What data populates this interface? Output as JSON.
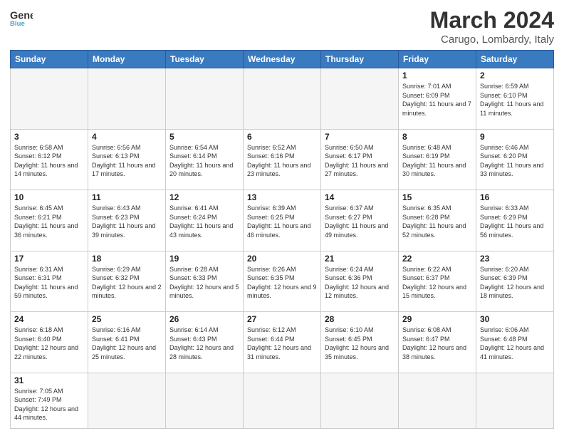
{
  "header": {
    "logo_general": "General",
    "logo_blue": "Blue",
    "month": "March 2024",
    "location": "Carugo, Lombardy, Italy"
  },
  "days_of_week": [
    "Sunday",
    "Monday",
    "Tuesday",
    "Wednesday",
    "Thursday",
    "Friday",
    "Saturday"
  ],
  "weeks": [
    [
      {
        "day": "",
        "info": ""
      },
      {
        "day": "",
        "info": ""
      },
      {
        "day": "",
        "info": ""
      },
      {
        "day": "",
        "info": ""
      },
      {
        "day": "",
        "info": ""
      },
      {
        "day": "1",
        "info": "Sunrise: 7:01 AM\nSunset: 6:09 PM\nDaylight: 11 hours and 7 minutes."
      },
      {
        "day": "2",
        "info": "Sunrise: 6:59 AM\nSunset: 6:10 PM\nDaylight: 11 hours and 11 minutes."
      }
    ],
    [
      {
        "day": "3",
        "info": "Sunrise: 6:58 AM\nSunset: 6:12 PM\nDaylight: 11 hours and 14 minutes."
      },
      {
        "day": "4",
        "info": "Sunrise: 6:56 AM\nSunset: 6:13 PM\nDaylight: 11 hours and 17 minutes."
      },
      {
        "day": "5",
        "info": "Sunrise: 6:54 AM\nSunset: 6:14 PM\nDaylight: 11 hours and 20 minutes."
      },
      {
        "day": "6",
        "info": "Sunrise: 6:52 AM\nSunset: 6:16 PM\nDaylight: 11 hours and 23 minutes."
      },
      {
        "day": "7",
        "info": "Sunrise: 6:50 AM\nSunset: 6:17 PM\nDaylight: 11 hours and 27 minutes."
      },
      {
        "day": "8",
        "info": "Sunrise: 6:48 AM\nSunset: 6:19 PM\nDaylight: 11 hours and 30 minutes."
      },
      {
        "day": "9",
        "info": "Sunrise: 6:46 AM\nSunset: 6:20 PM\nDaylight: 11 hours and 33 minutes."
      }
    ],
    [
      {
        "day": "10",
        "info": "Sunrise: 6:45 AM\nSunset: 6:21 PM\nDaylight: 11 hours and 36 minutes."
      },
      {
        "day": "11",
        "info": "Sunrise: 6:43 AM\nSunset: 6:23 PM\nDaylight: 11 hours and 39 minutes."
      },
      {
        "day": "12",
        "info": "Sunrise: 6:41 AM\nSunset: 6:24 PM\nDaylight: 11 hours and 43 minutes."
      },
      {
        "day": "13",
        "info": "Sunrise: 6:39 AM\nSunset: 6:25 PM\nDaylight: 11 hours and 46 minutes."
      },
      {
        "day": "14",
        "info": "Sunrise: 6:37 AM\nSunset: 6:27 PM\nDaylight: 11 hours and 49 minutes."
      },
      {
        "day": "15",
        "info": "Sunrise: 6:35 AM\nSunset: 6:28 PM\nDaylight: 11 hours and 52 minutes."
      },
      {
        "day": "16",
        "info": "Sunrise: 6:33 AM\nSunset: 6:29 PM\nDaylight: 11 hours and 56 minutes."
      }
    ],
    [
      {
        "day": "17",
        "info": "Sunrise: 6:31 AM\nSunset: 6:31 PM\nDaylight: 11 hours and 59 minutes."
      },
      {
        "day": "18",
        "info": "Sunrise: 6:29 AM\nSunset: 6:32 PM\nDaylight: 12 hours and 2 minutes."
      },
      {
        "day": "19",
        "info": "Sunrise: 6:28 AM\nSunset: 6:33 PM\nDaylight: 12 hours and 5 minutes."
      },
      {
        "day": "20",
        "info": "Sunrise: 6:26 AM\nSunset: 6:35 PM\nDaylight: 12 hours and 9 minutes."
      },
      {
        "day": "21",
        "info": "Sunrise: 6:24 AM\nSunset: 6:36 PM\nDaylight: 12 hours and 12 minutes."
      },
      {
        "day": "22",
        "info": "Sunrise: 6:22 AM\nSunset: 6:37 PM\nDaylight: 12 hours and 15 minutes."
      },
      {
        "day": "23",
        "info": "Sunrise: 6:20 AM\nSunset: 6:39 PM\nDaylight: 12 hours and 18 minutes."
      }
    ],
    [
      {
        "day": "24",
        "info": "Sunrise: 6:18 AM\nSunset: 6:40 PM\nDaylight: 12 hours and 22 minutes."
      },
      {
        "day": "25",
        "info": "Sunrise: 6:16 AM\nSunset: 6:41 PM\nDaylight: 12 hours and 25 minutes."
      },
      {
        "day": "26",
        "info": "Sunrise: 6:14 AM\nSunset: 6:43 PM\nDaylight: 12 hours and 28 minutes."
      },
      {
        "day": "27",
        "info": "Sunrise: 6:12 AM\nSunset: 6:44 PM\nDaylight: 12 hours and 31 minutes."
      },
      {
        "day": "28",
        "info": "Sunrise: 6:10 AM\nSunset: 6:45 PM\nDaylight: 12 hours and 35 minutes."
      },
      {
        "day": "29",
        "info": "Sunrise: 6:08 AM\nSunset: 6:47 PM\nDaylight: 12 hours and 38 minutes."
      },
      {
        "day": "30",
        "info": "Sunrise: 6:06 AM\nSunset: 6:48 PM\nDaylight: 12 hours and 41 minutes."
      }
    ],
    [
      {
        "day": "31",
        "info": "Sunrise: 7:05 AM\nSunset: 7:49 PM\nDaylight: 12 hours and 44 minutes."
      },
      {
        "day": "",
        "info": ""
      },
      {
        "day": "",
        "info": ""
      },
      {
        "day": "",
        "info": ""
      },
      {
        "day": "",
        "info": ""
      },
      {
        "day": "",
        "info": ""
      },
      {
        "day": "",
        "info": ""
      }
    ]
  ]
}
